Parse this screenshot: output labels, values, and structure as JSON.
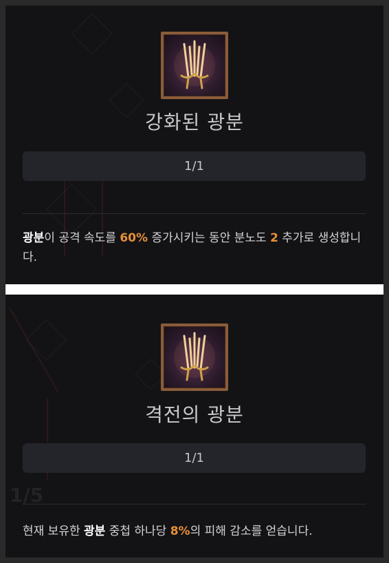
{
  "cards": [
    {
      "icon": "crossed-swords-icon",
      "title": "강화된 광분",
      "rank": "1/1",
      "description": [
        {
          "t": "광분",
          "s": "kw"
        },
        {
          "t": "이 공격 속도를 ",
          "s": ""
        },
        {
          "t": "60%",
          "s": "num"
        },
        {
          "t": " 증가시키는 동안 분노도 ",
          "s": ""
        },
        {
          "t": "2",
          "s": "num"
        },
        {
          "t": " 추가로 생성합니다.",
          "s": ""
        }
      ]
    },
    {
      "icon": "crossed-swords-icon",
      "title": "격전의 광분",
      "rank": "1/1",
      "background_rank": "1/5",
      "description": [
        {
          "t": "현재 보유한 ",
          "s": ""
        },
        {
          "t": "광분",
          "s": "kw"
        },
        {
          "t": " 중첩 하나당 ",
          "s": ""
        },
        {
          "t": "8%",
          "s": "num"
        },
        {
          "t": "의 피해 감소를 얻습니다.",
          "s": ""
        }
      ]
    }
  ],
  "colors": {
    "panel_bg": "#131316",
    "rank_bar_bg": "#24252b",
    "highlight_number": "#e8903a",
    "icon_frame": "#8a5c3a"
  }
}
